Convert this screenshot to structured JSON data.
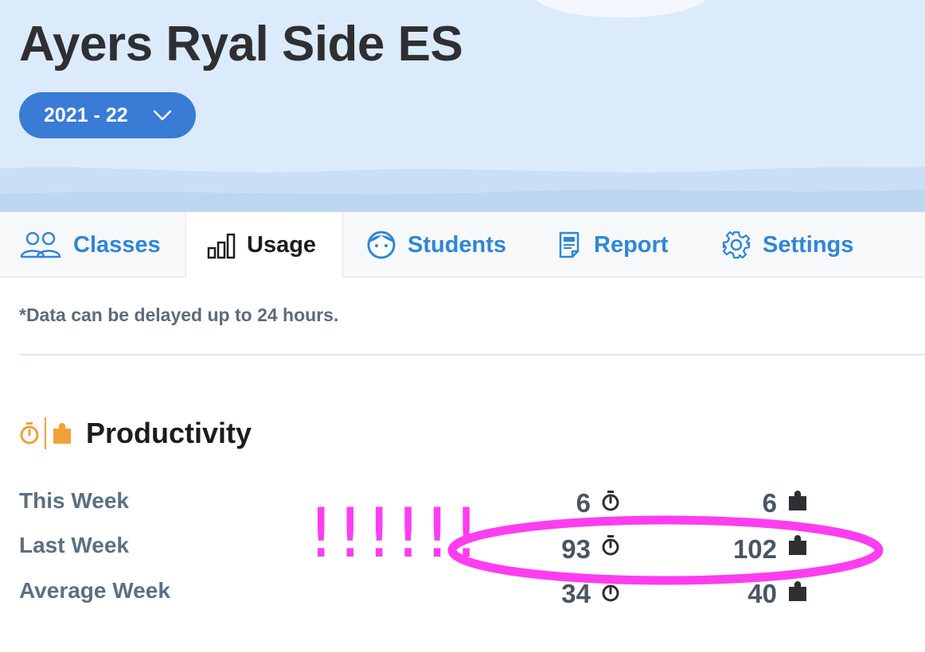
{
  "header": {
    "school_name": "Ayers Ryal Side ES",
    "year_selector": "2021 - 22"
  },
  "tabs": [
    {
      "label": "Classes",
      "icon": "people-icon",
      "active": false
    },
    {
      "label": "Usage",
      "icon": "bar-chart-icon",
      "active": true
    },
    {
      "label": "Students",
      "icon": "face-icon",
      "active": false
    },
    {
      "label": "Report",
      "icon": "report-icon",
      "active": false
    },
    {
      "label": "Settings",
      "icon": "gear-icon",
      "active": false
    }
  ],
  "notice": "*Data can be delayed up to 24 hours.",
  "productivity": {
    "title": "Productivity",
    "rows": [
      {
        "label": "This Week",
        "time": "6",
        "pieces": "6"
      },
      {
        "label": "Last Week",
        "time": "93",
        "pieces": "102"
      },
      {
        "label": "Average Week",
        "time": "34",
        "pieces": "40"
      }
    ]
  },
  "annotation": {
    "marks": "!!!!!!",
    "color": "#ff3df0"
  },
  "colors": {
    "accent": "#3a7bd5",
    "tab_link": "#2f86d6",
    "productivity_icon": "#f0a13a"
  }
}
